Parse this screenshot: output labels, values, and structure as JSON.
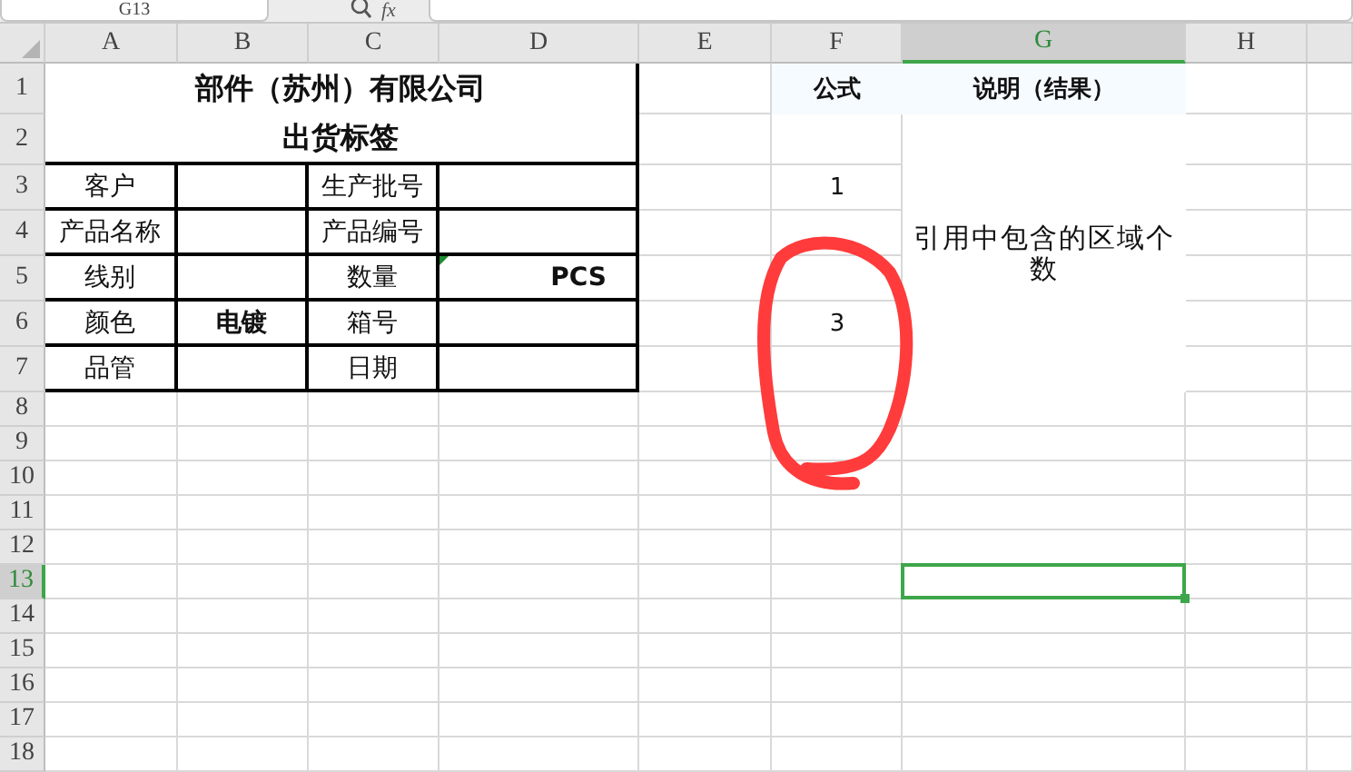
{
  "formula_bar": {
    "name_box": "G13",
    "fx_label": "fx"
  },
  "columns": [
    {
      "label": "A",
      "selected": false
    },
    {
      "label": "B",
      "selected": false
    },
    {
      "label": "C",
      "selected": false
    },
    {
      "label": "D",
      "selected": false
    },
    {
      "label": "E",
      "selected": false
    },
    {
      "label": "F",
      "selected": false
    },
    {
      "label": "G",
      "selected": true
    },
    {
      "label": "H",
      "selected": false
    }
  ],
  "rows": [
    {
      "label": "1",
      "selected": false
    },
    {
      "label": "2",
      "selected": false
    },
    {
      "label": "3",
      "selected": false
    },
    {
      "label": "4",
      "selected": false
    },
    {
      "label": "5",
      "selected": false
    },
    {
      "label": "6",
      "selected": false
    },
    {
      "label": "7",
      "selected": false
    },
    {
      "label": "8",
      "selected": false
    },
    {
      "label": "9",
      "selected": false
    },
    {
      "label": "10",
      "selected": false
    },
    {
      "label": "11",
      "selected": false
    },
    {
      "label": "12",
      "selected": false
    },
    {
      "label": "13",
      "selected": true
    },
    {
      "label": "14",
      "selected": false
    },
    {
      "label": "15",
      "selected": false
    },
    {
      "label": "16",
      "selected": false
    },
    {
      "label": "17",
      "selected": false
    },
    {
      "label": "18",
      "selected": false
    }
  ],
  "label_table": {
    "title": "部件（苏州）有限公司",
    "subtitle": "出货标签",
    "rows": [
      [
        {
          "kind": "text",
          "text": "客户",
          "bold": false
        },
        {
          "kind": "blank"
        },
        {
          "kind": "text",
          "text": "生产批号",
          "bold": false
        },
        {
          "kind": "blank"
        }
      ],
      [
        {
          "kind": "text",
          "text": "产品名称",
          "bold": false
        },
        {
          "kind": "blank"
        },
        {
          "kind": "text",
          "text": "产品编号",
          "bold": false
        },
        {
          "kind": "blank"
        }
      ],
      [
        {
          "kind": "text",
          "text": "线别",
          "bold": false
        },
        {
          "kind": "blank"
        },
        {
          "kind": "text",
          "text": "数量",
          "bold": false
        },
        {
          "kind": "unit",
          "text": "PCS",
          "bold": true,
          "error_mark": true
        }
      ],
      [
        {
          "kind": "text",
          "text": "颜色",
          "bold": false
        },
        {
          "kind": "text",
          "text": "电镀",
          "bold": true
        },
        {
          "kind": "text",
          "text": "箱号",
          "bold": false
        },
        {
          "kind": "blank"
        }
      ],
      [
        {
          "kind": "text",
          "text": "品管",
          "bold": false
        },
        {
          "kind": "blank"
        },
        {
          "kind": "text",
          "text": "日期",
          "bold": false
        },
        {
          "kind": "blank"
        }
      ]
    ]
  },
  "formula_table": {
    "headers": [
      "公式",
      "说明（结果）"
    ],
    "results": [
      "1",
      "3"
    ],
    "description": "引用中包含的区域个数"
  }
}
